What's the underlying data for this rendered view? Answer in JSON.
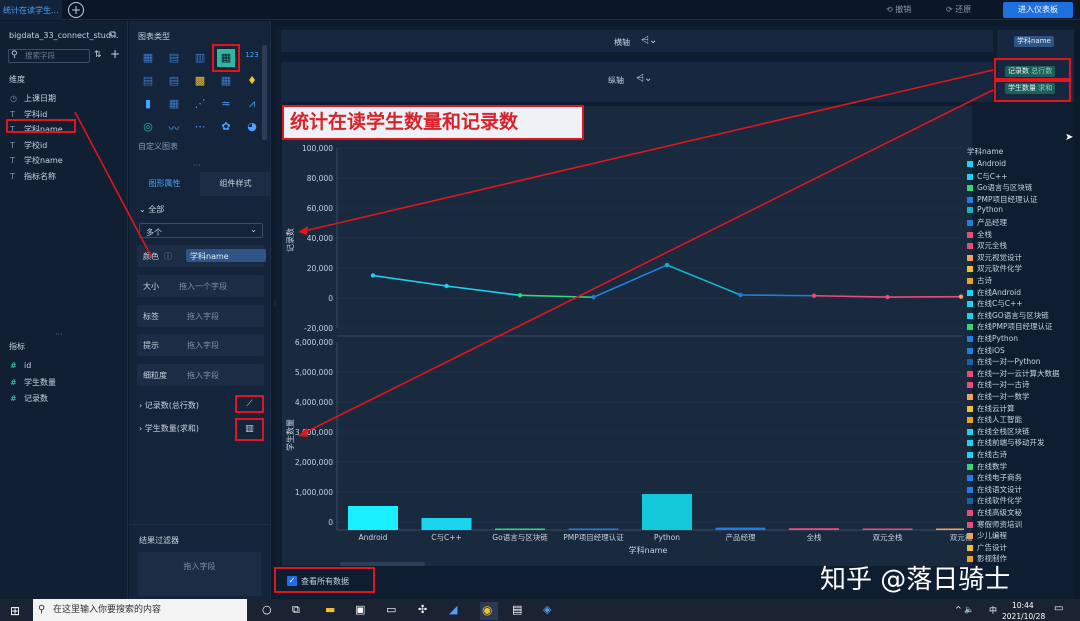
{
  "tabs": {
    "active": "统计在读学生...",
    "add": "+"
  },
  "toolbar": {
    "undo": "撤销",
    "redo": "还原",
    "enter_dashboard": "进入仪表板"
  },
  "left": {
    "dataset": "bigdata_33_connect_stud...",
    "search_placeholder": "搜索字段",
    "dim_title": "维度",
    "dimensions": [
      {
        "icon": "◷",
        "label": "上课日期"
      },
      {
        "icon": "T",
        "label": "学科id"
      },
      {
        "icon": "T",
        "label": "学科name"
      },
      {
        "icon": "T",
        "label": "学校id"
      },
      {
        "icon": "T",
        "label": "学校name"
      },
      {
        "icon": "T",
        "label": "指标名称"
      }
    ],
    "measure_title": "指标",
    "measures": [
      {
        "icon": "#",
        "label": "id"
      },
      {
        "icon": "#",
        "label": "学生数量"
      },
      {
        "icon": "#",
        "label": "记录数"
      }
    ]
  },
  "mid": {
    "chart_type_title": "图表类型",
    "custom_chart": "自定义图表",
    "tab_graphic": "图形属性",
    "tab_style": "组件样式",
    "all": "全部",
    "multi": "多个",
    "color_label": "颜色",
    "color_value": "学科name",
    "size_label": "大小",
    "size_drop": "拖入一个字段",
    "label_label": "标签",
    "label_drop": "拖入字段",
    "tip_label": "提示",
    "tip_drop": "拖入字段",
    "grain_label": "细粒度",
    "grain_drop": "拖入字段",
    "m1": "记录数(总行数)",
    "m2": "学生数量(求和)",
    "filter_title": "结果过滤器",
    "filter_drop": "拖入字段"
  },
  "axes": {
    "x_label": "横轴",
    "x_pill": "学科name",
    "y_label": "纵轴",
    "y_pill1_name": "记录数",
    "y_pill1_agg": "总行数",
    "y_pill2_name": "学生数量",
    "y_pill2_agg": "求和"
  },
  "annotation": "统计在读学生数量和记录数",
  "view_all": "查看所有数据",
  "chart_data": [
    {
      "type": "line",
      "ylabel": "记录数",
      "ylim": [
        -20000,
        100000
      ],
      "yticks": [
        "100,000",
        "80,000",
        "60,000",
        "40,000",
        "20,000",
        "0",
        "-20,000"
      ],
      "categories": [
        "Android",
        "C与C++",
        "Go语言与区块链",
        "PMP项目经理认证",
        "Python",
        "产品经理",
        "全栈",
        "双元全栈",
        "双元视"
      ],
      "values": [
        15000,
        8000,
        1800,
        500,
        22000,
        2000,
        1500,
        600,
        900
      ]
    },
    {
      "type": "bar",
      "ylabel": "学生数量",
      "xlabel": "学科name",
      "ylim": [
        0,
        6000000
      ],
      "yticks": [
        "6,000,000",
        "5,000,000",
        "4,000,000",
        "3,000,000",
        "2,000,000",
        "1,000,000",
        "0"
      ],
      "categories": [
        "Android",
        "C与C++",
        "Go语言与区块链",
        "PMP项目经理认证",
        "Python",
        "产品经理",
        "全栈",
        "双元全栈",
        "双元视"
      ],
      "values": [
        800000,
        400000,
        50000,
        30000,
        1200000,
        80000,
        60000,
        30000,
        40000
      ]
    }
  ],
  "legend": {
    "title": "学科name",
    "items": [
      {
        "label": "Android",
        "color": "#19d3f0"
      },
      {
        "label": "C与C++",
        "color": "#19d3f0"
      },
      {
        "label": "Go语言与区块链",
        "color": "#2fd87a"
      },
      {
        "label": "PMP项目经理认证",
        "color": "#1f7fe0"
      },
      {
        "label": "Python",
        "color": "#12b3c9"
      },
      {
        "label": "产品经理",
        "color": "#1f7fe0"
      },
      {
        "label": "全栈",
        "color": "#e84c7a"
      },
      {
        "label": "双元全栈",
        "color": "#e84c7a"
      },
      {
        "label": "双元视觉设计",
        "color": "#f0a060"
      },
      {
        "label": "双元软件化学",
        "color": "#f0c030"
      },
      {
        "label": "古诗",
        "color": "#f0a020"
      },
      {
        "label": "在线Android",
        "color": "#19d3f0"
      },
      {
        "label": "在线C与C++",
        "color": "#19d3f0"
      },
      {
        "label": "在线GO语言与区块链",
        "color": "#19d3f0"
      },
      {
        "label": "在线PMP项目经理认证",
        "color": "#2fd87a"
      },
      {
        "label": "在线Python",
        "color": "#1f7fe0"
      },
      {
        "label": "在线iOS",
        "color": "#1f7fe0"
      },
      {
        "label": "在线一对一Python",
        "color": "#1f5fa0"
      },
      {
        "label": "在线一对一云计算大数据",
        "color": "#e84c7a"
      },
      {
        "label": "在线一对一古诗",
        "color": "#e84c7a"
      },
      {
        "label": "在线一对一数学",
        "color": "#f0a060"
      },
      {
        "label": "在线云计算",
        "color": "#f0c030"
      },
      {
        "label": "在线人工智能",
        "color": "#f0a020"
      },
      {
        "label": "在线全栈区块链",
        "color": "#19d3f0"
      },
      {
        "label": "在线前端与移动开发",
        "color": "#19d3f0"
      },
      {
        "label": "在线古诗",
        "color": "#19d3f0"
      },
      {
        "label": "在线数学",
        "color": "#2fd87a"
      },
      {
        "label": "在线电子商务",
        "color": "#1f7fe0"
      },
      {
        "label": "在线语文设计",
        "color": "#1f7fe0"
      },
      {
        "label": "在线软件化学",
        "color": "#1f5fa0"
      },
      {
        "label": "在线高级文秘",
        "color": "#e84c7a"
      },
      {
        "label": "寒假师资培训",
        "color": "#e84c7a"
      },
      {
        "label": "少儿编程",
        "color": "#f0a060"
      },
      {
        "label": "广告设计",
        "color": "#f0c030"
      },
      {
        "label": "影视制作",
        "color": "#f0a020"
      }
    ]
  },
  "watermark": "知乎 @落日骑士",
  "taskbar": {
    "search": "在这里输入你要搜索的内容",
    "time": "10:44",
    "date": "2021/10/28",
    "ime": "中"
  }
}
